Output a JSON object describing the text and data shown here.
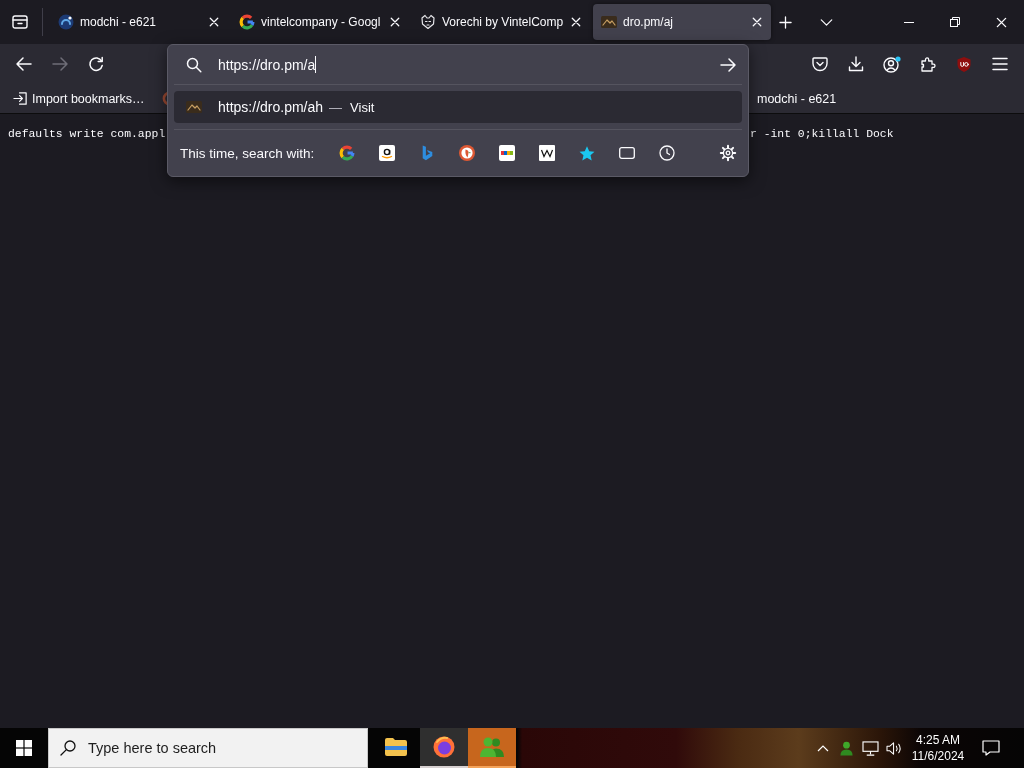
{
  "tabs": [
    {
      "title": "modchi - e621",
      "selected": false
    },
    {
      "title": "vintelcompany - Googl",
      "selected": false
    },
    {
      "title": "Vorechi by VintelComp",
      "selected": false
    },
    {
      "title": "dro.pm/aj",
      "selected": true
    }
  ],
  "nav_buttons": [
    {
      "kind": "back",
      "disabled": false
    },
    {
      "kind": "forward",
      "disabled": true
    },
    {
      "kind": "reload",
      "disabled": false
    }
  ],
  "address_bar": {
    "value": "https://dro.pm/a"
  },
  "suggestions": [
    {
      "url": "https://dro.pm/ah",
      "separator": "—",
      "action": "Visit",
      "selected": true
    }
  ],
  "search_with": {
    "label": "This time, search with:"
  },
  "bookmarks": [
    {
      "kind": "import",
      "title": "Import bookmarks…"
    },
    {
      "kind": "site",
      "title": "modchi - e621"
    }
  ],
  "page": {
    "text_start": "defaults write com.appl",
    "text_end": "r -int 0;killall Dock"
  },
  "taskbar": {
    "search": {
      "placeholder": "Type here to search"
    },
    "apps": [
      {
        "kind": "folder",
        "selected": false,
        "attention": false
      },
      {
        "kind": "browser",
        "selected": true,
        "attention": false
      },
      {
        "kind": "people",
        "selected": false,
        "attention": true
      }
    ],
    "clock": {
      "time": "4:25 AM",
      "date": "11/6/2024"
    }
  }
}
